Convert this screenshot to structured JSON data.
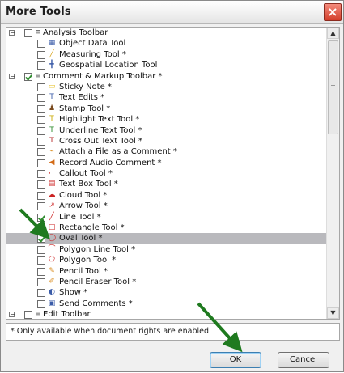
{
  "window": {
    "title": "More Tools",
    "close_label": "×"
  },
  "tree": [
    {
      "kind": "group",
      "expanded": true,
      "checked": false,
      "label": "Analysis Toolbar"
    },
    {
      "kind": "tool",
      "checked": false,
      "icon": "object-data-icon",
      "glyph": "▦",
      "color": "#3a5ba8",
      "label": "Object Data Tool"
    },
    {
      "kind": "tool",
      "checked": false,
      "icon": "measuring-icon",
      "glyph": "╱",
      "color": "#d8a31a",
      "label": "Measuring Tool *"
    },
    {
      "kind": "tool",
      "checked": false,
      "icon": "geospatial-location-icon",
      "glyph": "╋",
      "color": "#3a5ba8",
      "label": "Geospatial Location Tool"
    },
    {
      "kind": "group",
      "expanded": true,
      "checked": true,
      "label": "Comment & Markup Toolbar *"
    },
    {
      "kind": "tool",
      "checked": false,
      "icon": "sticky-note-icon",
      "glyph": "▭",
      "color": "#e3b80d",
      "label": "Sticky Note *"
    },
    {
      "kind": "tool",
      "checked": false,
      "icon": "text-edits-icon",
      "glyph": "T",
      "color": "#3a5ba8",
      "label": "Text Edits *"
    },
    {
      "kind": "tool",
      "checked": false,
      "icon": "stamp-icon",
      "glyph": "♟",
      "color": "#7a4a1e",
      "label": "Stamp Tool *"
    },
    {
      "kind": "tool",
      "checked": false,
      "icon": "highlight-text-icon",
      "glyph": "T",
      "color": "#c9a800",
      "label": "Highlight Text Tool *"
    },
    {
      "kind": "tool",
      "checked": false,
      "icon": "underline-text-icon",
      "glyph": "T",
      "color": "#2a8a2a",
      "label": "Underline Text Tool *"
    },
    {
      "kind": "tool",
      "checked": false,
      "icon": "cross-out-text-icon",
      "glyph": "T",
      "color": "#b52a2a",
      "label": "Cross Out Text Tool *"
    },
    {
      "kind": "tool",
      "checked": false,
      "icon": "attach-file-icon",
      "glyph": "⌁",
      "color": "#d98a1a",
      "label": "Attach a File as a Comment *"
    },
    {
      "kind": "tool",
      "checked": false,
      "icon": "record-audio-icon",
      "glyph": "◀",
      "color": "#d26a16",
      "label": "Record Audio Comment *"
    },
    {
      "kind": "tool",
      "checked": false,
      "icon": "callout-icon",
      "glyph": "⌐",
      "color": "#cc2222",
      "label": "Callout Tool *"
    },
    {
      "kind": "tool",
      "checked": false,
      "icon": "text-box-icon",
      "glyph": "▤",
      "color": "#cc2222",
      "label": "Text Box Tool *"
    },
    {
      "kind": "tool",
      "checked": false,
      "icon": "cloud-icon",
      "glyph": "☁",
      "color": "#cc2222",
      "label": "Cloud Tool *"
    },
    {
      "kind": "tool",
      "checked": false,
      "icon": "arrow-tool-icon",
      "glyph": "↗",
      "color": "#cc2222",
      "label": "Arrow Tool *"
    },
    {
      "kind": "tool",
      "checked": true,
      "icon": "line-tool-icon",
      "glyph": "╱",
      "color": "#cc2222",
      "label": "Line Tool *"
    },
    {
      "kind": "tool",
      "checked": false,
      "icon": "rectangle-tool-icon",
      "glyph": "□",
      "color": "#cc2222",
      "label": "Rectangle Tool *"
    },
    {
      "kind": "tool",
      "checked": true,
      "selected": true,
      "icon": "oval-tool-icon",
      "glyph": "◯",
      "color": "#cc2222",
      "label": "Oval Tool *"
    },
    {
      "kind": "tool",
      "checked": false,
      "icon": "polygon-line-icon",
      "glyph": "⌒",
      "color": "#cc2222",
      "label": "Polygon Line Tool *"
    },
    {
      "kind": "tool",
      "checked": false,
      "icon": "polygon-icon",
      "glyph": "⬠",
      "color": "#cc2222",
      "label": "Polygon Tool *"
    },
    {
      "kind": "tool",
      "checked": false,
      "icon": "pencil-icon",
      "glyph": "✎",
      "color": "#d98a1a",
      "label": "Pencil Tool *"
    },
    {
      "kind": "tool",
      "checked": false,
      "icon": "pencil-eraser-icon",
      "glyph": "✐",
      "color": "#d98a1a",
      "label": "Pencil Eraser Tool *"
    },
    {
      "kind": "tool",
      "checked": false,
      "icon": "show-icon",
      "glyph": "◐",
      "color": "#3a5ba8",
      "label": "Show *"
    },
    {
      "kind": "tool",
      "checked": false,
      "icon": "send-comments-icon",
      "glyph": "▣",
      "color": "#3a5ba8",
      "label": "Send Comments *"
    },
    {
      "kind": "group",
      "expanded": true,
      "checked": false,
      "label": "Edit Toolbar"
    }
  ],
  "footer_note": "* Only available when document rights are enabled",
  "buttons": {
    "ok": "OK",
    "cancel": "Cancel"
  },
  "colors": {
    "annotation_arrow": "#1f7a1f",
    "selected_row": "#b9b9bd"
  }
}
